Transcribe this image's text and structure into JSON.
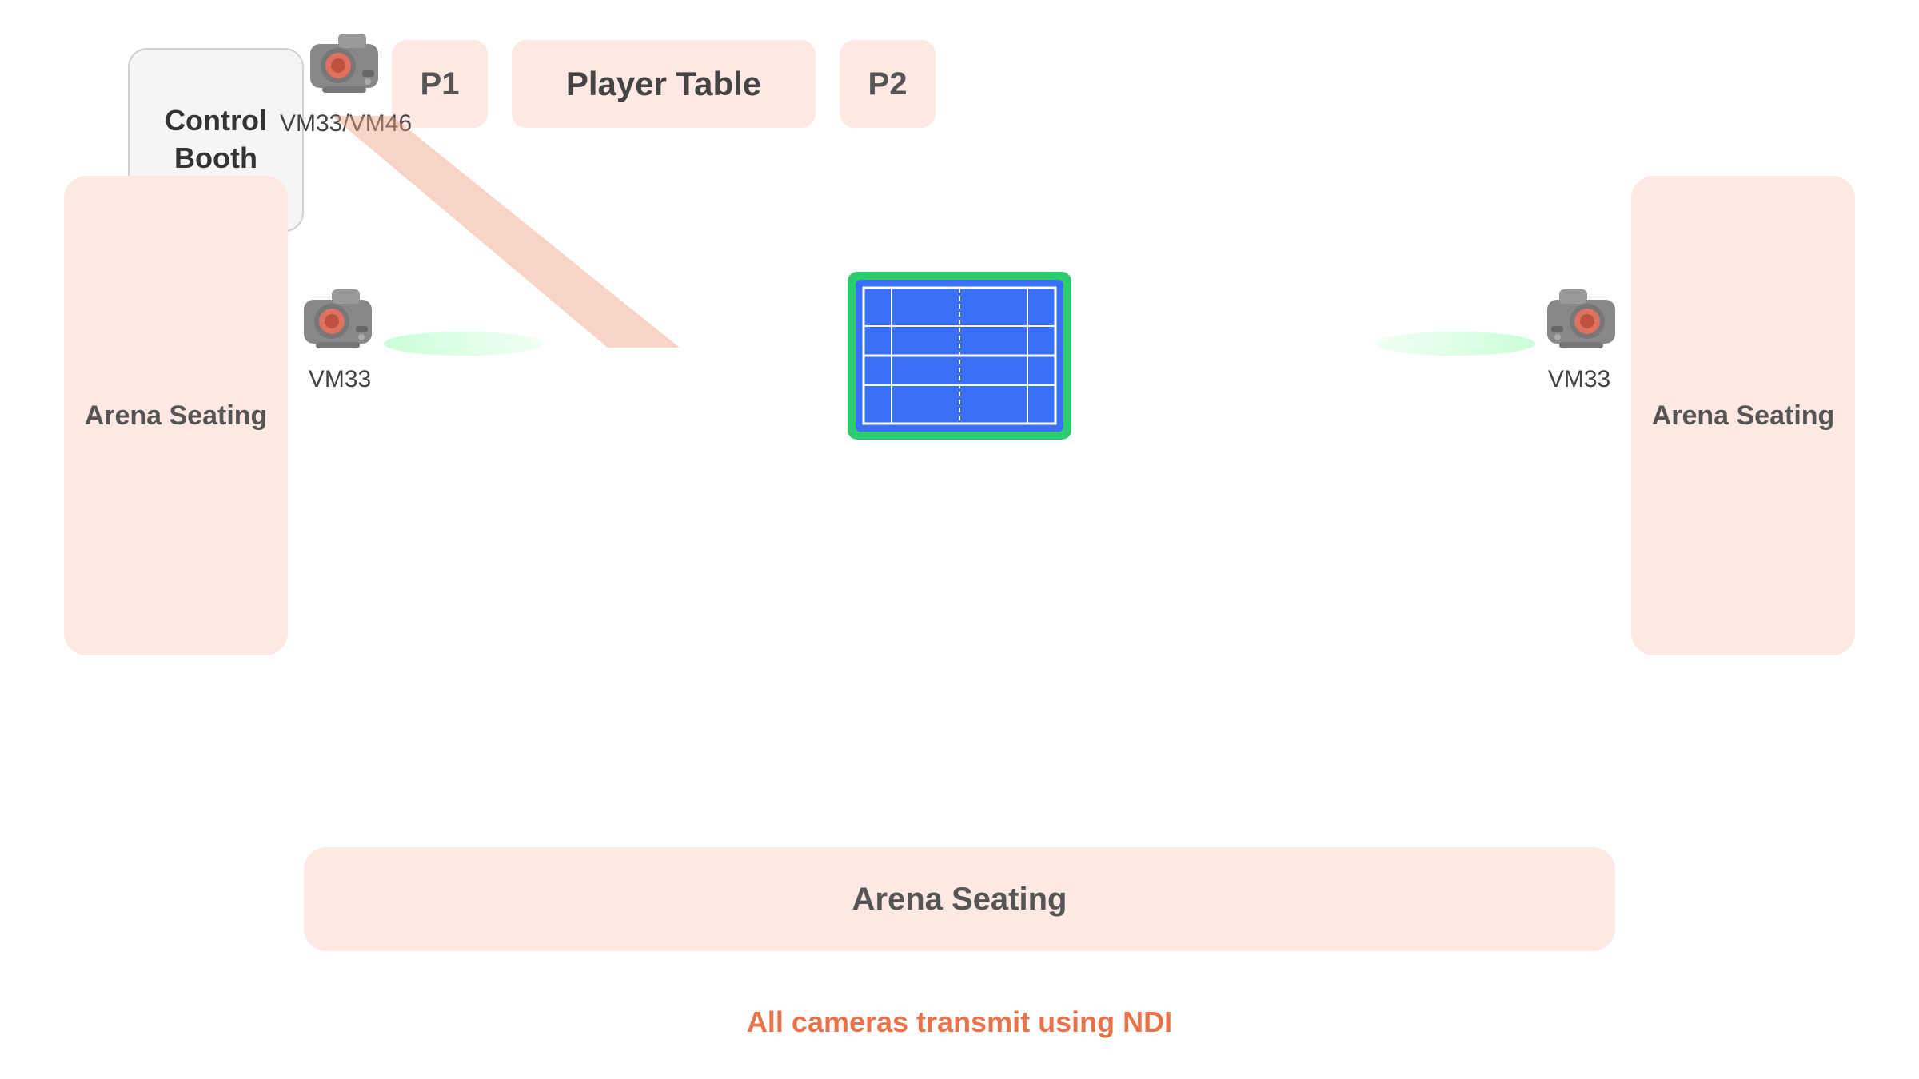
{
  "controlBooth": {
    "label": "Control\nBooth"
  },
  "topArea": {
    "p1Label": "P1",
    "playerTableLabel": "Player Table",
    "p2Label": "P2"
  },
  "arenas": {
    "leftLabel": "Arena Seating",
    "rightLabel": "Arena Seating",
    "bottomLabel": "Arena Seating"
  },
  "cameras": {
    "topLabel": "VM33/VM46",
    "leftLabel": "VM33",
    "rightLabel": "VM33"
  },
  "ndiNote": "All cameras transmit using NDI",
  "colors": {
    "arenaFill": "#fde8e4",
    "courtGreen": "#3ec97a",
    "courtBlue": "#3a6ff7",
    "beamOrange": "#e8c0b0",
    "beamGreen": "#b4eedd",
    "ndiOrange": "#e8734a"
  }
}
